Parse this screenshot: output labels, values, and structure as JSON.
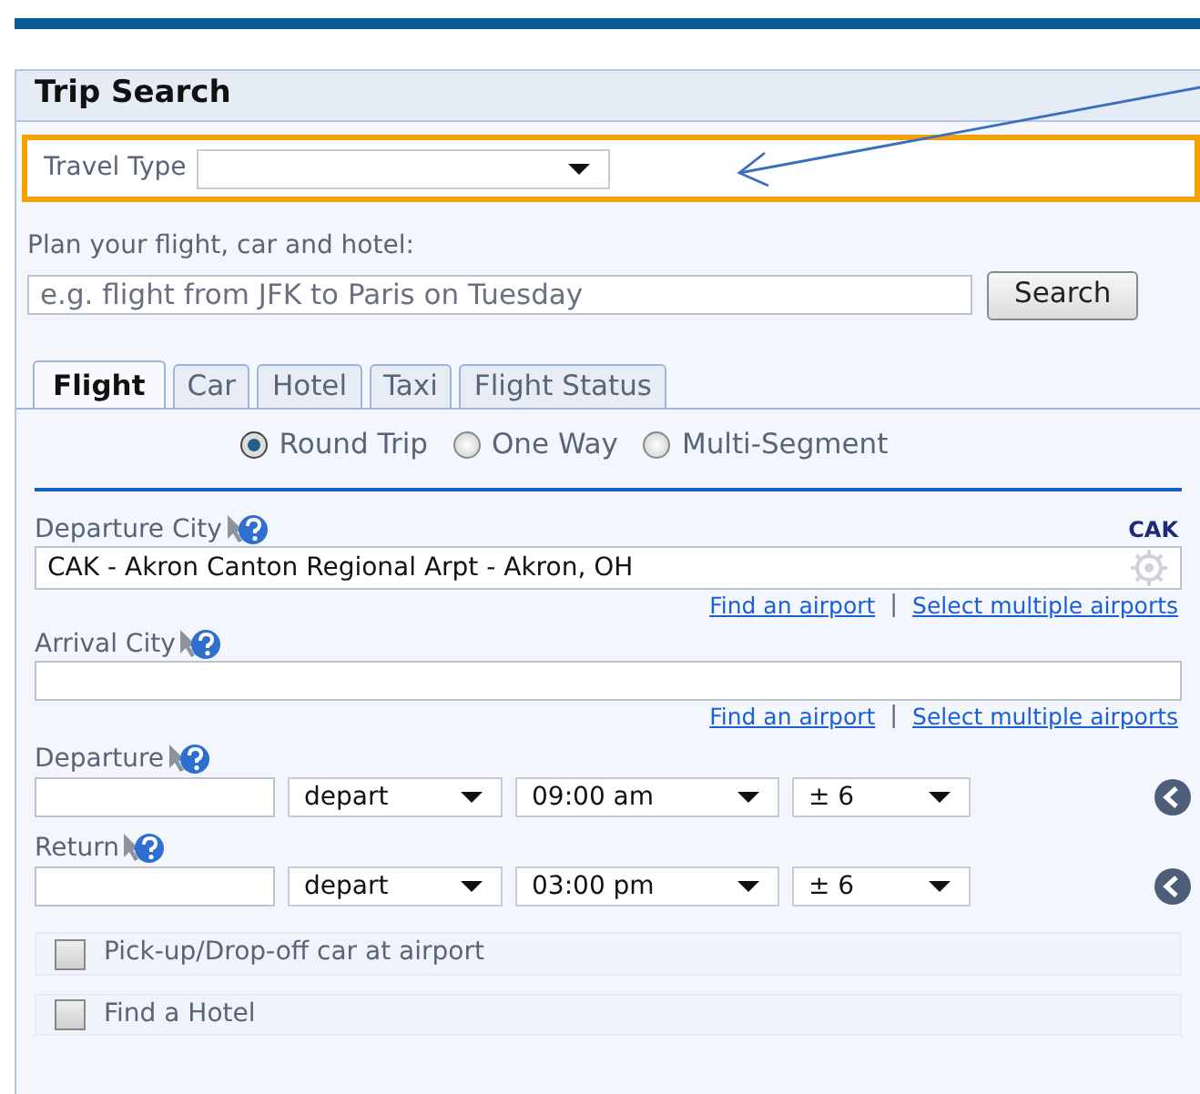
{
  "panel": {
    "title": "Trip Search"
  },
  "travel_type": {
    "label": "Travel Type"
  },
  "plan": {
    "label": "Plan your flight, car and hotel:",
    "placeholder": "e.g. flight from JFK to Paris on Tuesday",
    "button": "Search"
  },
  "tabs": [
    {
      "label": "Flight",
      "selected": true
    },
    {
      "label": "Car",
      "selected": false
    },
    {
      "label": "Hotel",
      "selected": false
    },
    {
      "label": "Taxi",
      "selected": false
    },
    {
      "label": "Flight Status",
      "selected": false
    }
  ],
  "trip_types": [
    {
      "label": "Round Trip",
      "selected": true
    },
    {
      "label": "One Way",
      "selected": false
    },
    {
      "label": "Multi-Segment",
      "selected": false
    }
  ],
  "departure_city": {
    "label": "Departure City",
    "code": "CAK",
    "value": "CAK - Akron Canton Regional Arpt - Akron, OH",
    "links": [
      "Find an airport",
      "Select multiple airports"
    ],
    "separator": "|"
  },
  "arrival_city": {
    "label": "Arrival City",
    "links": [
      "Find an airport",
      "Select multiple airports"
    ],
    "separator": "|"
  },
  "dates": [
    {
      "label": "Departure",
      "mode": "depart",
      "time": "09:00 am",
      "range": "± 6"
    },
    {
      "label": "Return",
      "mode": "depart",
      "time": "03:00 pm",
      "range": "± 6"
    }
  ],
  "options": [
    {
      "label": "Pick-up/Drop-off car at airport",
      "checked": false
    },
    {
      "label": "Find a Hotel",
      "checked": false
    }
  ]
}
